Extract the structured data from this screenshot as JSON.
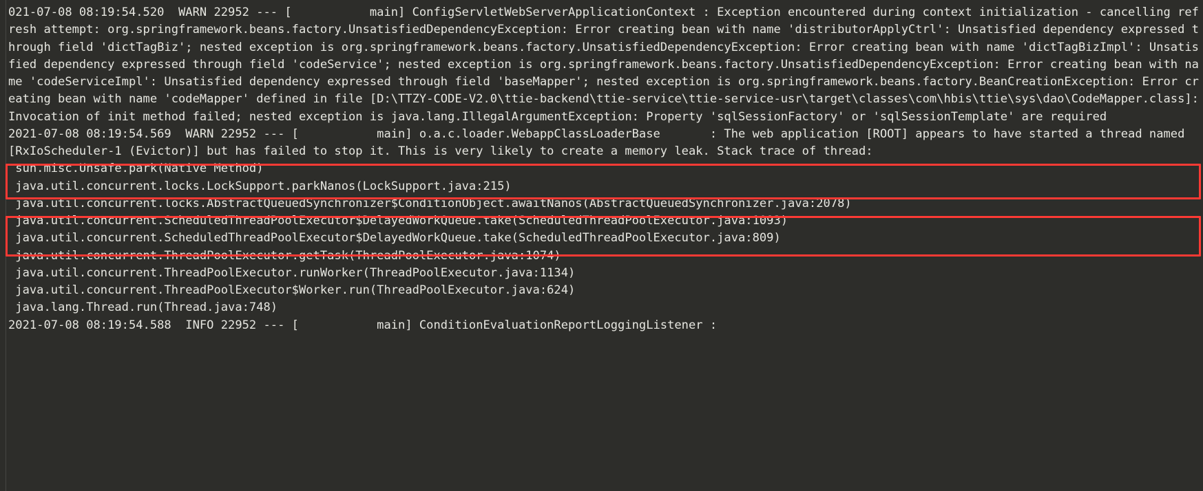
{
  "theme": {
    "background": "#2d2d2a",
    "text_color": "#e6e6e0",
    "highlight_color": "#fc3a34",
    "gutter_color": "#4a4a46"
  },
  "console": {
    "title": "application-log-console",
    "entries": [
      {
        "id": "entry-warn-config-servlet",
        "level": "WARN",
        "timestamp": "021-07-08 08:19:54.520",
        "pid": "22952",
        "thread": "main",
        "logger": "ConfigServletWebServerApplicationContext",
        "text": "021-07-08 08:19:54.520  WARN 22952 --- [           main] ConfigServletWebServerApplicationContext : Exception encountered during context initialization - cancelling refresh attempt: org.springframework.beans.factory.UnsatisfiedDependencyException: Error creating bean with name 'distributorApplyCtrl': Unsatisfied dependency expressed through field 'dictTagBiz'; nested exception is org.springframework.beans.factory.UnsatisfiedDependencyException: Error creating bean with name 'dictTagBizImpl': Unsatisfied dependency expressed through field 'codeService'; nested exception is org.springframework.beans.factory.UnsatisfiedDependencyException: Error creating bean with name 'codeServiceImpl': Unsatisfied dependency expressed through field 'baseMapper'; nested exception is org.springframework.beans.factory.BeanCreationException: Error creating bean with name 'codeMapper' defined in file [D:\\TTZY-CODE-V2.0\\ttie-backend\\ttie-service\\ttie-service-usr\\target\\classes\\com\\hbis\\ttie\\sys\\dao\\CodeMapper.class]: Invocation of init method failed; nested exception is java.lang.IllegalArgumentException: Property 'sqlSessionFactory' or 'sqlSessionTemplate' are required"
      },
      {
        "id": "entry-warn-webapp-classloader",
        "level": "WARN",
        "timestamp": "2021-07-08 08:19:54.569",
        "pid": "22952",
        "thread": "main",
        "logger": "o.a.c.loader.WebappClassLoaderBase",
        "text": "2021-07-08 08:19:54.569  WARN 22952 --- [           main] o.a.c.loader.WebappClassLoaderBase       : The web application [ROOT] appears to have started a thread named [RxIoScheduler-1 (Evictor)] but has failed to stop it. This is very likely to create a memory leak. Stack trace of thread:"
      }
    ],
    "stack_trace": [
      " sun.misc.Unsafe.park(Native Method)",
      " java.util.concurrent.locks.LockSupport.parkNanos(LockSupport.java:215)",
      " java.util.concurrent.locks.AbstractQueuedSynchronizer$ConditionObject.awaitNanos(AbstractQueuedSynchronizer.java:2078)",
      " java.util.concurrent.ScheduledThreadPoolExecutor$DelayedWorkQueue.take(ScheduledThreadPoolExecutor.java:1093)",
      " java.util.concurrent.ScheduledThreadPoolExecutor$DelayedWorkQueue.take(ScheduledThreadPoolExecutor.java:809)",
      " java.util.concurrent.ThreadPoolExecutor.getTask(ThreadPoolExecutor.java:1074)",
      " java.util.concurrent.ThreadPoolExecutor.runWorker(ThreadPoolExecutor.java:1134)",
      " java.util.concurrent.ThreadPoolExecutor$Worker.run(ThreadPoolExecutor.java:624)",
      " java.lang.Thread.run(Thread.java:748)"
    ],
    "final_entry": {
      "id": "entry-info-condition-report",
      "level": "INFO",
      "timestamp": "2021-07-08 08:19:54.588",
      "pid": "22952",
      "thread": "main",
      "logger": "ConditionEvaluationReportLoggingListener",
      "text": "2021-07-08 08:19:54.588  INFO 22952 --- [           main] ConditionEvaluationReportLoggingListener :"
    },
    "highlights": [
      {
        "id": "highlight-box-1",
        "label": "sql-session-factory-error-highlight",
        "content": "Invocation of init method failed; nested exception is java.lang.IllegalArgumentException: Property 'sqlSessionFactory' or 'sqlSessionTemplate' are required"
      },
      {
        "id": "highlight-box-2",
        "label": "memory-leak-warning-highlight",
        "content": "ROOT] appears to have started a thread named [RxIoScheduler-1 (Evictor)] but has failed to stop it. This is very likely to create a memory leak. Stack trace of thread:"
      }
    ]
  }
}
